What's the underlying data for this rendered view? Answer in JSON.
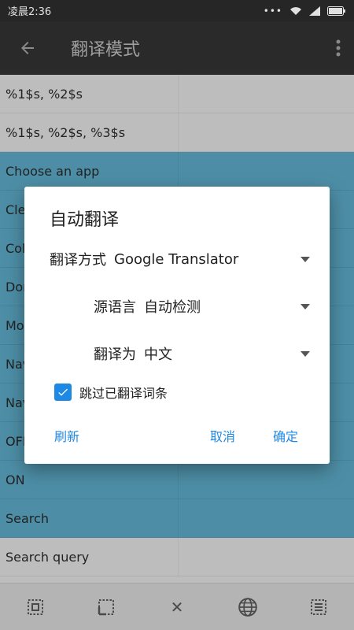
{
  "status_bar": {
    "time": "凌晨2:36",
    "dots": "•••"
  },
  "app_bar": {
    "title": "翻译模式"
  },
  "list": [
    {
      "text": "%1$s, %2$s",
      "highlight": false
    },
    {
      "text": "%1$s, %2$s, %3$s",
      "highlight": false
    },
    {
      "text": "Choose an app",
      "highlight": true
    },
    {
      "text": "Cle",
      "highlight": true
    },
    {
      "text": "Col",
      "highlight": true
    },
    {
      "text": "Dor",
      "highlight": true
    },
    {
      "text": "Mo",
      "highlight": true
    },
    {
      "text": "Nav",
      "highlight": true
    },
    {
      "text": "Nav",
      "highlight": true
    },
    {
      "text": "OFF",
      "highlight": true
    },
    {
      "text": "ON",
      "highlight": true
    },
    {
      "text": "Search",
      "highlight": true
    },
    {
      "text": "Search query",
      "highlight": false
    }
  ],
  "dialog": {
    "title": "自动翻译",
    "fields": [
      {
        "label": "翻译方式",
        "value": "Google Translator"
      },
      {
        "label": "源语言",
        "value": "自动检测"
      },
      {
        "label": "翻译为",
        "value": "中文"
      }
    ],
    "skip_translated_label": "跳过已翻译词条",
    "skip_translated_checked": true,
    "buttons": {
      "refresh": "刷新",
      "cancel": "取消",
      "ok": "确定"
    }
  },
  "toolbar": {
    "icons": [
      "select-all-icon",
      "select-partial-icon",
      "close-icon",
      "globe-icon",
      "list-select-icon"
    ],
    "close_glyph": "✕"
  },
  "colors": {
    "accent": "#1e88e5",
    "highlight_row": "#4d8ea6"
  }
}
